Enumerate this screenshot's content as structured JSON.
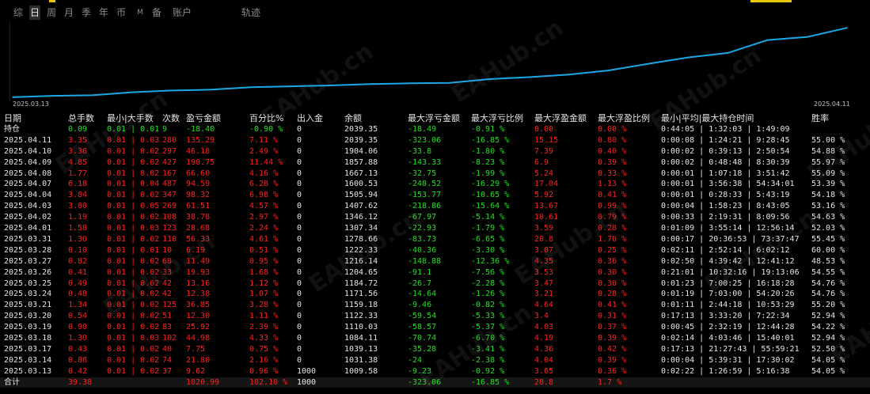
{
  "tabs": [
    {
      "label": "综",
      "active": false,
      "small": false
    },
    {
      "label": "日",
      "active": true,
      "small": false
    },
    {
      "label": "周",
      "active": false,
      "small": false
    },
    {
      "label": "月",
      "active": false,
      "small": false
    },
    {
      "label": "季",
      "active": false,
      "small": false
    },
    {
      "label": "年",
      "active": false,
      "small": false
    },
    {
      "label": "币",
      "active": false,
      "small": false
    },
    {
      "label": "M",
      "active": false,
      "small": true
    },
    {
      "label": "备",
      "active": false,
      "small": false
    },
    {
      "label": "账户",
      "active": false,
      "small": false
    },
    {
      "label": "轨迹",
      "active": false,
      "small": false
    }
  ],
  "chart_data": {
    "type": "line",
    "x": [
      "2025.03.13",
      "2025.03.14",
      "2025.03.17",
      "2025.03.18",
      "2025.03.19",
      "2025.03.20",
      "2025.03.21",
      "2025.03.24",
      "2025.03.25",
      "2025.03.26",
      "2025.03.27",
      "2025.03.28",
      "2025.03.31",
      "2025.04.01",
      "2025.04.02",
      "2025.04.03",
      "2025.04.04",
      "2025.04.07",
      "2025.04.08",
      "2025.04.09",
      "2025.04.10",
      "2025.04.11"
    ],
    "y": [
      1009.58,
      1031.38,
      1039.13,
      1084.11,
      1110.03,
      1122.33,
      1159.18,
      1171.56,
      1184.72,
      1204.65,
      1216.14,
      1222.33,
      1278.66,
      1307.34,
      1346.12,
      1407.62,
      1505.94,
      1600.53,
      1667.13,
      1857.88,
      1904.06,
      2039.35
    ],
    "x_start_label": "2025.03.13",
    "x_end_label": "2025.04.11",
    "line_color": "#1aa7e6"
  },
  "table": {
    "headers": [
      "日期",
      "总手数",
      "最小|大手数",
      "次数",
      "盈亏金额",
      "百分比%",
      "出入金",
      "余额",
      "最大浮亏金额",
      "最大浮亏比例",
      "最大浮盈金额",
      "最大浮盈比例",
      "最小|平均|最大持仓时间",
      "胜率"
    ],
    "holding": {
      "date": "持仓",
      "lots": "0.09",
      "minmax": "0.01 | 0.01",
      "count": "9",
      "pnl": "-18.40",
      "pct": "-0.90 %",
      "io": "0",
      "balance": "2039.35",
      "ml": "-18.49",
      "mlp": "-0.91 %",
      "mp": "0.00",
      "mpp": "0.00 %",
      "time": "0:44:05 | 1:32:03 | 1:49:09",
      "win": ""
    },
    "rows": [
      {
        "date": "2025.04.11",
        "lots": "3.35",
        "minmax": "0.01 | 0.03",
        "count": "280",
        "pnl": "135.29",
        "pct": "7.11 %",
        "io": "0",
        "balance": "2039.35",
        "ml": "-323.06",
        "mlp": "-16.85 %",
        "mp": "15.15",
        "mpp": "0.80 %",
        "time": "0:00:08 | 1:24:21 | 9:28:45",
        "win": "55.00 %"
      },
      {
        "date": "2025.04.10",
        "lots": "3.36",
        "minmax": "0.01 | 0.02",
        "count": "297",
        "pnl": "46.18",
        "pct": "2.49 %",
        "io": "0",
        "balance": "1904.06",
        "ml": "-33.8",
        "mlp": "-1.80 %",
        "mp": "7.39",
        "mpp": "0.40 %",
        "time": "0:00:02 | 0:39:13 | 2:50:54",
        "win": "54.88 %"
      },
      {
        "date": "2025.04.09",
        "lots": "4.85",
        "minmax": "0.01 | 0.02",
        "count": "427",
        "pnl": "190.75",
        "pct": "11.44 %",
        "io": "0",
        "balance": "1857.88",
        "ml": "-143.33",
        "mlp": "-8.23 %",
        "mp": "6.9",
        "mpp": "0.39 %",
        "time": "0:00:02 | 0:48:48 | 8:30:39",
        "win": "55.97 %"
      },
      {
        "date": "2025.04.08",
        "lots": "1.77",
        "minmax": "0.01 | 0.02",
        "count": "167",
        "pnl": "66.60",
        "pct": "4.16 %",
        "io": "0",
        "balance": "1667.13",
        "ml": "-32.75",
        "mlp": "-1.99 %",
        "mp": "5.24",
        "mpp": "0.33 %",
        "time": "0:00:01 | 1:07:18 | 3:51:42",
        "win": "55.09 %"
      },
      {
        "date": "2025.04.07",
        "lots": "6.18",
        "minmax": "0.01 | 0.04",
        "count": "487",
        "pnl": "94.59",
        "pct": "6.28 %",
        "io": "0",
        "balance": "1600.53",
        "ml": "-248.52",
        "mlp": "-16.29 %",
        "mp": "17.04",
        "mpp": "1.13 %",
        "time": "0:00:01 | 3:56:38 | 54:34:01",
        "win": "53.39 %"
      },
      {
        "date": "2025.04.04",
        "lots": "3.84",
        "minmax": "0.01 | 0.02",
        "count": "347",
        "pnl": "98.32",
        "pct": "6.98 %",
        "io": "0",
        "balance": "1505.94",
        "ml": "-153.77",
        "mlp": "-10.65 %",
        "mp": "5.92",
        "mpp": "0.41 %",
        "time": "0:00:01 | 0:28:33 | 5:43:19",
        "win": "54.18 %"
      },
      {
        "date": "2025.04.03",
        "lots": "3.80",
        "minmax": "0.01 | 0.05",
        "count": "269",
        "pnl": "61.51",
        "pct": "4.57 %",
        "io": "0",
        "balance": "1407.62",
        "ml": "-218.86",
        "mlp": "-15.64 %",
        "mp": "13.67",
        "mpp": "0.99 %",
        "time": "0:00:04 | 1:58:23 | 8:43:05",
        "win": "53.16 %"
      },
      {
        "date": "2025.04.02",
        "lots": "1.19",
        "minmax": "0.01 | 0.02",
        "count": "108",
        "pnl": "38.78",
        "pct": "2.97 %",
        "io": "0",
        "balance": "1346.12",
        "ml": "-67.97",
        "mlp": "-5.14 %",
        "mp": "10.61",
        "mpp": "0.79 %",
        "time": "0:00:33 | 2:19:31 | 8:09:56",
        "win": "54.63 %"
      },
      {
        "date": "2025.04.01",
        "lots": "1.58",
        "minmax": "0.01 | 0.03",
        "count": "123",
        "pnl": "28.68",
        "pct": "2.24 %",
        "io": "0",
        "balance": "1307.34",
        "ml": "-22.93",
        "mlp": "-1.79 %",
        "mp": "3.59",
        "mpp": "0.28 %",
        "time": "0:01:09 | 3:55:14 | 12:56:14",
        "win": "52.03 %"
      },
      {
        "date": "2025.03.31",
        "lots": "1.30",
        "minmax": "0.01 | 0.02",
        "count": "110",
        "pnl": "56.33",
        "pct": "4.61 %",
        "io": "0",
        "balance": "1278.66",
        "ml": "-83.73",
        "mlp": "-6.65 %",
        "mp": "20.8",
        "mpp": "1.70 %",
        "time": "0:00:17 | 20:36:53 | 73:37:47",
        "win": "55.45 %"
      },
      {
        "date": "2025.03.28",
        "lots": "0.10",
        "minmax": "0.01 | 0.01",
        "count": "10",
        "pnl": "6.19",
        "pct": "0.51 %",
        "io": "0",
        "balance": "1222.33",
        "ml": "-40.36",
        "mlp": "-3.30 %",
        "mp": "3.07",
        "mpp": "0.25 %",
        "time": "0:02:11 | 2:52:14 | 6:02:12",
        "win": "60.00 %"
      },
      {
        "date": "2025.03.27",
        "lots": "0.82",
        "minmax": "0.01 | 0.02",
        "count": "68",
        "pnl": "11.49",
        "pct": "0.95 %",
        "io": "0",
        "balance": "1216.14",
        "ml": "-148.88",
        "mlp": "-12.36 %",
        "mp": "4.35",
        "mpp": "0.36 %",
        "time": "0:02:50 | 4:39:42 | 12:41:12",
        "win": "48.53 %"
      },
      {
        "date": "2025.03.26",
        "lots": "0.41",
        "minmax": "0.01 | 0.02",
        "count": "33",
        "pnl": "19.93",
        "pct": "1.68 %",
        "io": "0",
        "balance": "1204.65",
        "ml": "-91.1",
        "mlp": "-7.56 %",
        "mp": "3.53",
        "mpp": "0.30 %",
        "time": "0:21:01 | 10:32:16 | 19:13:06",
        "win": "54.55 %"
      },
      {
        "date": "2025.03.25",
        "lots": "0.49",
        "minmax": "0.01 | 0.02",
        "count": "42",
        "pnl": "13.16",
        "pct": "1.12 %",
        "io": "0",
        "balance": "1184.72",
        "ml": "-26.7",
        "mlp": "-2.28 %",
        "mp": "3.47",
        "mpp": "0.30 %",
        "time": "0:01:23 | 7:00:25 | 16:18:28",
        "win": "54.76 %"
      },
      {
        "date": "2025.03.24",
        "lots": "0.48",
        "minmax": "0.01 | 0.02",
        "count": "42",
        "pnl": "12.38",
        "pct": "1.07 %",
        "io": "0",
        "balance": "1171.56",
        "ml": "-14.64",
        "mlp": "-1.26 %",
        "mp": "3.21",
        "mpp": "0.28 %",
        "time": "0:01:19 | 7:03:00 | 54:20:26",
        "win": "54.76 %"
      },
      {
        "date": "2025.03.21",
        "lots": "1.34",
        "minmax": "0.01 | 0.02",
        "count": "125",
        "pnl": "36.85",
        "pct": "3.28 %",
        "io": "0",
        "balance": "1159.18",
        "ml": "-9.46",
        "mlp": "-0.82 %",
        "mp": "4.64",
        "mpp": "0.41 %",
        "time": "0:01:11 | 2:44:18 | 10:53:29",
        "win": "55.20 %"
      },
      {
        "date": "2025.03.20",
        "lots": "0.54",
        "minmax": "0.01 | 0.02",
        "count": "51",
        "pnl": "12.30",
        "pct": "1.11 %",
        "io": "0",
        "balance": "1122.33",
        "ml": "-59.54",
        "mlp": "-5.33 %",
        "mp": "3.4",
        "mpp": "0.31 %",
        "time": "0:17:13 | 3:33:20 | 7:22:34",
        "win": "52.94 %"
      },
      {
        "date": "2025.03.19",
        "lots": "0.90",
        "minmax": "0.01 | 0.02",
        "count": "83",
        "pnl": "25.92",
        "pct": "2.39 %",
        "io": "0",
        "balance": "1110.03",
        "ml": "-58.57",
        "mlp": "-5.37 %",
        "mp": "4.03",
        "mpp": "0.37 %",
        "time": "0:00:45 | 2:32:19 | 12:44:28",
        "win": "54.22 %"
      },
      {
        "date": "2025.03.18",
        "lots": "1.30",
        "minmax": "0.01 | 0.03",
        "count": "102",
        "pnl": "44.98",
        "pct": "4.33 %",
        "io": "0",
        "balance": "1084.11",
        "ml": "-70.74",
        "mlp": "-6.70 %",
        "mp": "4.19",
        "mpp": "0.39 %",
        "time": "0:02:14 | 4:03:46 | 15:40:01",
        "win": "52.94 %"
      },
      {
        "date": "2025.03.17",
        "lots": "0.43",
        "minmax": "0.01 | 0.02",
        "count": "40",
        "pnl": "7.75",
        "pct": "0.75 %",
        "io": "0",
        "balance": "1039.13",
        "ml": "-35.28",
        "mlp": "-3.41 %",
        "mp": "4.36",
        "mpp": "0.42 %",
        "time": "0:17:13 | 21:27:43 | 55:59:21",
        "win": "52.50 %"
      },
      {
        "date": "2025.03.14",
        "lots": "0.86",
        "minmax": "0.01 | 0.02",
        "count": "74",
        "pnl": "21.80",
        "pct": "2.16 %",
        "io": "0",
        "balance": "1031.38",
        "ml": "-24",
        "mlp": "-2.38 %",
        "mp": "4.04",
        "mpp": "0.39 %",
        "time": "0:00:04 | 5:39:31 | 17:30:02",
        "win": "54.05 %"
      },
      {
        "date": "2025.03.13",
        "lots": "0.42",
        "minmax": "0.01 | 0.02",
        "count": "37",
        "pnl": "9.62",
        "pct": "0.96 %",
        "io": "1000",
        "balance": "1009.58",
        "ml": "-9.23",
        "mlp": "-0.92 %",
        "mp": "3.65",
        "mpp": "0.36 %",
        "time": "0:02:22 | 1:26:59 | 5:16:38",
        "win": "54.05 %"
      }
    ],
    "total": {
      "date": "合计",
      "lots": "39.38",
      "minmax": "",
      "count": "",
      "pnl": "1020.99",
      "pct": "102.10 %",
      "io": "1000",
      "balance": "",
      "ml": "-323.06",
      "mlp": "-16.85 %",
      "mp": "20.8",
      "mpp": "1.7 %",
      "time": "",
      "win": ""
    }
  },
  "watermark": "EAHub.cn",
  "colors": {
    "profit": "#ff2020",
    "loss": "#20e020",
    "line": "#1aa7e6"
  }
}
